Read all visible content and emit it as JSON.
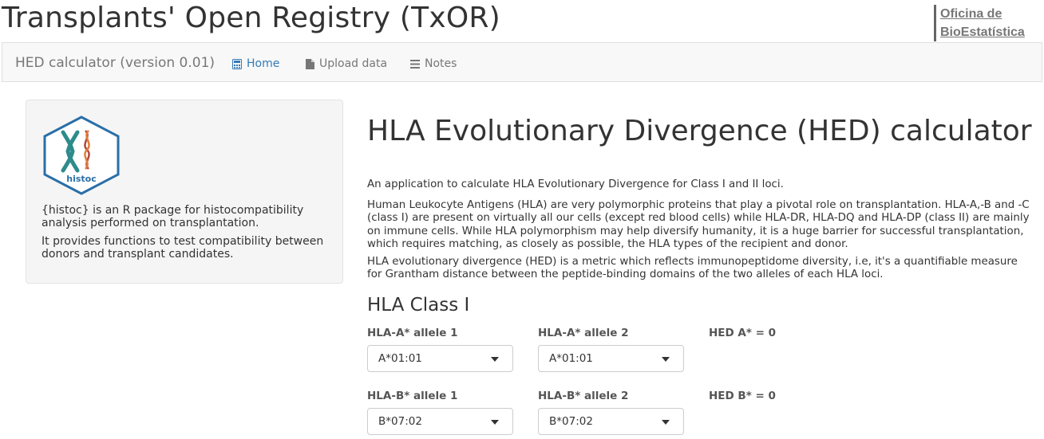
{
  "header": {
    "title": "Transplants' Open Registry (TxOR)",
    "org_line1": "Oficina de",
    "org_line2": "BioEstatística"
  },
  "navbar": {
    "brand": "HED calculator (version 0.01)",
    "items": [
      {
        "label": "Home",
        "icon": "calculator-icon",
        "active": true
      },
      {
        "label": "Upload data",
        "icon": "file-icon"
      },
      {
        "label": "Notes",
        "icon": "list-icon"
      }
    ]
  },
  "sidebar": {
    "logo_text": "histoc",
    "p1": "{histoc} is an R package for histocompatibility analysis performed on transplantation.",
    "p2": "It provides functions to test compatibility between donors and transplant candidates."
  },
  "main": {
    "title": "HLA Evolutionary Divergence (HED) calculator",
    "p1": "An application to calculate HLA Evolutionary Divergence for Class I and II loci.",
    "p2": "Human Leukocyte Antigens (HLA) are very polymorphic proteins that play a pivotal role on transplantation. HLA-A,-B and -C (class I) are present on virtually all our cells (except red blood cells) while HLA-DR, HLA-DQ and HLA-DP (class II) are mainly on immune cells. While HLA polymorphism may help diversify humanity, it is a huge barrier for successful transplantation, which requires matching, as closely as possible, the HLA types of the recipient and donor.",
    "p3": "HLA evolutionary divergence (HED) is a metric which reflects immunopeptidome diversity, i.e, it's a quantifiable measure for Grantham distance between the peptide-binding domains of the two alleles of each HLA loci.",
    "class1_title": "HLA Class I",
    "rows": [
      {
        "label1": "HLA-A* allele 1",
        "value1": "A*01:01",
        "label2": "HLA-A* allele 2",
        "value2": "A*01:01",
        "result": "HED A* = 0"
      },
      {
        "label1": "HLA-B* allele 1",
        "value1": "B*07:02",
        "label2": "HLA-B* allele 2",
        "value2": "B*07:02",
        "result": "HED B* = 0"
      }
    ]
  },
  "colors": {
    "accent": "#337ab7",
    "logo_border": "#2a6fa8",
    "logo_text": "#2a6fa8"
  }
}
